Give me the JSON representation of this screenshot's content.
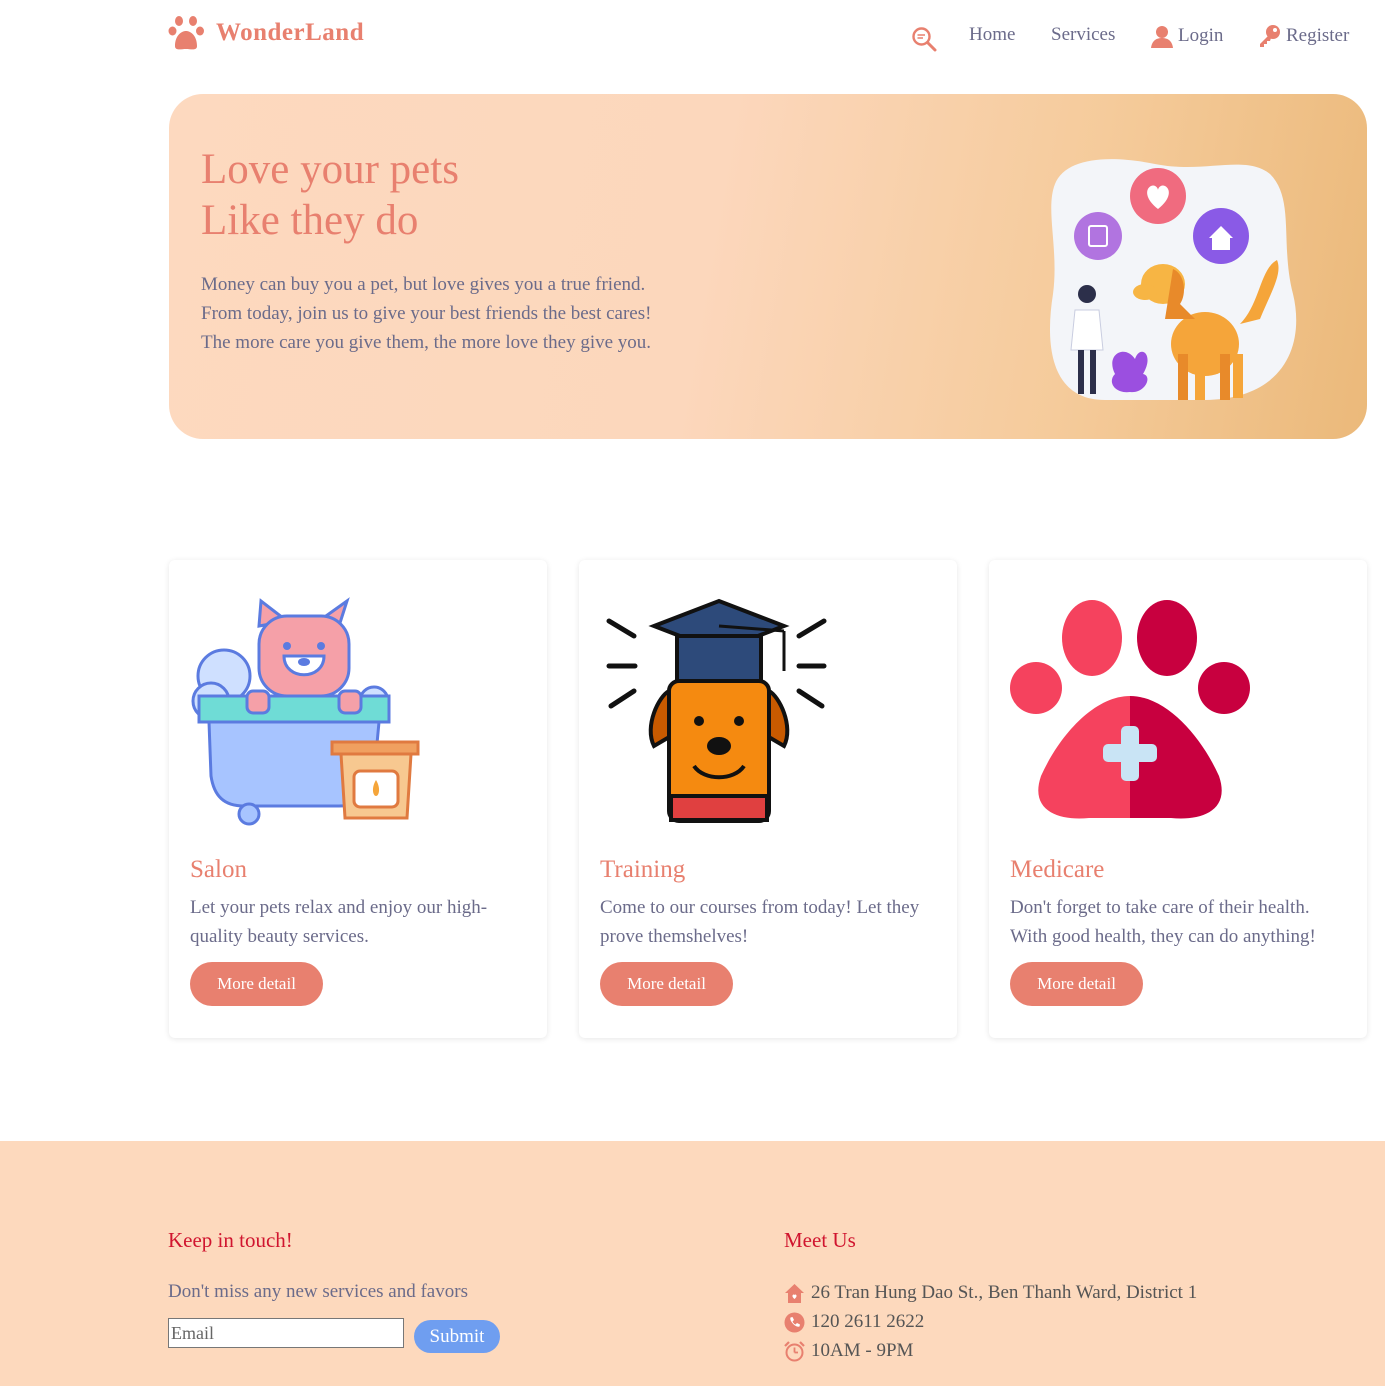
{
  "brand": {
    "name": "WonderLand",
    "accent": "#e8806f"
  },
  "nav": {
    "search_icon": "search-icon",
    "home": "Home",
    "services": "Services",
    "login": "Login",
    "register": "Register"
  },
  "hero": {
    "title_line1": "Love your pets",
    "title_line2": "Like they do",
    "text_line1": "Money can buy you a pet, but love gives you a true friend.",
    "text_line2": "From today, join us to give your best friends the best cares!",
    "text_line3": "The more care you give them, the more love they give you."
  },
  "cards": [
    {
      "title": "Salon",
      "text": "Let your pets relax and enjoy our high-quality beauty services.",
      "button": "More detail",
      "icon": "bath-dog-icon"
    },
    {
      "title": "Training",
      "text": "Come to our courses from today! Let they prove themshelves!",
      "button": "More detail",
      "icon": "graduate-dog-icon"
    },
    {
      "title": "Medicare",
      "text": "Don't forget to take care of their health. With good health, they can do anything!",
      "button": "More detail",
      "icon": "paw-medical-icon"
    }
  ],
  "footer": {
    "keep_heading": "Keep in touch!",
    "keep_text": "Don't miss any new services and favors",
    "email_placeholder": "Email",
    "submit": "Submit",
    "meet_heading": "Meet Us",
    "address": "26 Tran Hung Dao St., Ben Thanh Ward, District 1",
    "phone": "120 2611 2622",
    "hours": "10AM - 9PM",
    "heading_color": "#d0152f",
    "background": "#fdd9bd"
  }
}
